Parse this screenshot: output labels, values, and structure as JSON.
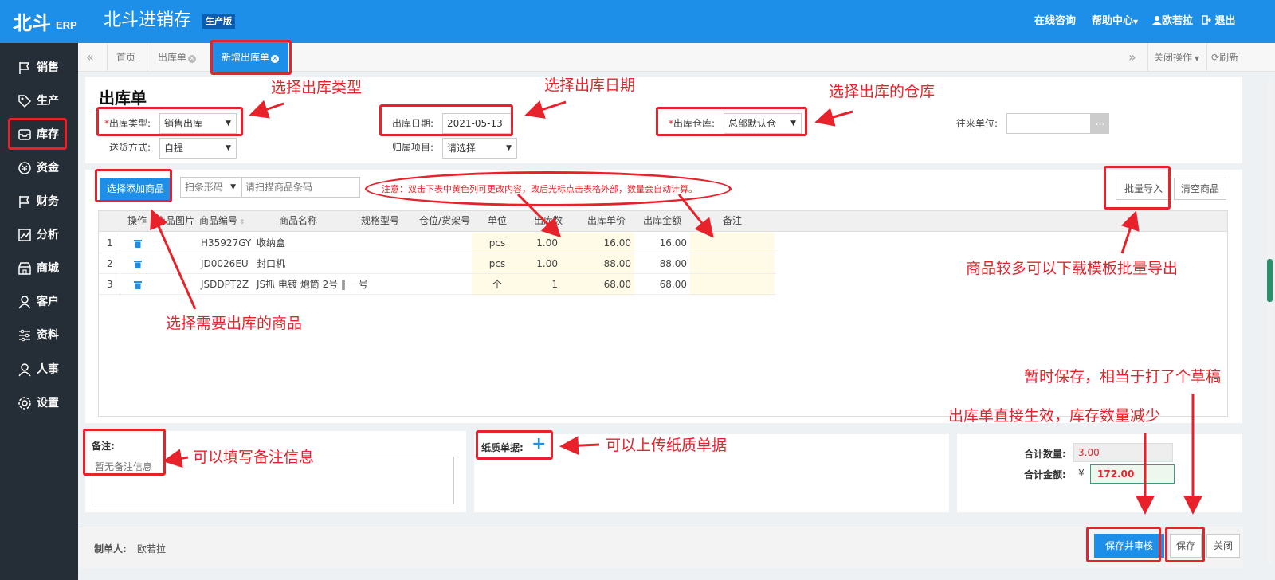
{
  "app": {
    "logo": "北斗",
    "logo_sub": "ERP",
    "title": "北斗进销存",
    "edition": "生产版"
  },
  "topnav": {
    "consult": "在线咨询",
    "help": "帮助中心",
    "user": "欧若拉",
    "logout": "退出"
  },
  "sidebar": {
    "items": [
      {
        "label": "销售",
        "icon": "flag-icon"
      },
      {
        "label": "生产",
        "icon": "tag-icon"
      },
      {
        "label": "库存",
        "icon": "inbox-icon"
      },
      {
        "label": "资金",
        "icon": "coin-icon"
      },
      {
        "label": "财务",
        "icon": "flag-icon"
      },
      {
        "label": "分析",
        "icon": "chart-icon"
      },
      {
        "label": "商城",
        "icon": "store-icon"
      },
      {
        "label": "客户",
        "icon": "person-icon"
      },
      {
        "label": "资料",
        "icon": "sliders-icon"
      },
      {
        "label": "人事",
        "icon": "person-icon"
      },
      {
        "label": "设置",
        "icon": "gear-icon"
      }
    ]
  },
  "tabs": {
    "items": [
      {
        "label": "首页"
      },
      {
        "label": "出库单"
      },
      {
        "label": "新增出库单"
      }
    ],
    "close_ops": "关闭操作",
    "refresh": "刷新"
  },
  "form": {
    "title": "出库单",
    "type_label": "出库类型:",
    "type_value": "销售出库",
    "date_label": "出库日期:",
    "date_value": "2021-05-13",
    "warehouse_label": "出库仓库:",
    "warehouse_value": "总部默认仓",
    "partner_label": "往来单位:",
    "partner_btn": "...",
    "delivery_label": "送货方式:",
    "delivery_value": "自提",
    "project_label": "归属项目:",
    "project_value": "请选择"
  },
  "toolbar": {
    "add_goods": "选择添加商品",
    "barcode_select": "扫条形码",
    "barcode_placeholder": "请扫描商品条码",
    "notice": "注意：双击下表中黄色列可更改内容，改后光标点击表格外部，数量会自动计算。",
    "batch_import": "批量导入",
    "clear_goods": "清空商品"
  },
  "table": {
    "headers": [
      "操作",
      "商品图片",
      "商品编号",
      "商品名称",
      "规格型号",
      "仓位/货架号",
      "单位",
      "出库数",
      "出库单价",
      "出库金额",
      "备注"
    ],
    "rows": [
      {
        "no": "1",
        "code": "H35927GY",
        "name": "收纳盒",
        "unit": "pcs",
        "qty": "1.00",
        "price": "16.00",
        "amount": "16.00"
      },
      {
        "no": "2",
        "code": "JD0026EU",
        "name": "封口机",
        "unit": "pcs",
        "qty": "1.00",
        "price": "88.00",
        "amount": "88.00"
      },
      {
        "no": "3",
        "code": "JSDDPT2Z",
        "name": "JS抓 电镀 炮筒 2号 ‖ 一号",
        "unit": "个",
        "qty": "1",
        "price": "68.00",
        "amount": "68.00"
      }
    ]
  },
  "note": {
    "label": "备注:",
    "placeholder": "暂无备注信息"
  },
  "paper": {
    "label": "纸质单据:",
    "add": "+"
  },
  "totals": {
    "qty_label": "合计数量:",
    "qty_value": "3.00",
    "amount_label": "合计金额:",
    "currency": "¥",
    "amount_value": "172.00"
  },
  "footer": {
    "maker_label": "制单人:",
    "maker": "欧若拉",
    "save_audit": "保存并审核",
    "save": "保存",
    "close": "关闭"
  },
  "annotations": {
    "type": "选择出库类型",
    "date": "选择出库日期",
    "warehouse": "选择出库的仓库",
    "goods": "选择需要出库的商品",
    "batch": "商品较多可以下载模板批量导出",
    "note": "可以填写备注信息",
    "paper": "可以上传纸质单据",
    "draft": "暂时保存，相当于打了个草稿",
    "audit": "出库单直接生效，库存数量减少"
  },
  "colors": {
    "brand": "#1e8fe8",
    "sidebar": "#252d36",
    "annotation": "#e8222b",
    "editable": "#fffbe6"
  }
}
